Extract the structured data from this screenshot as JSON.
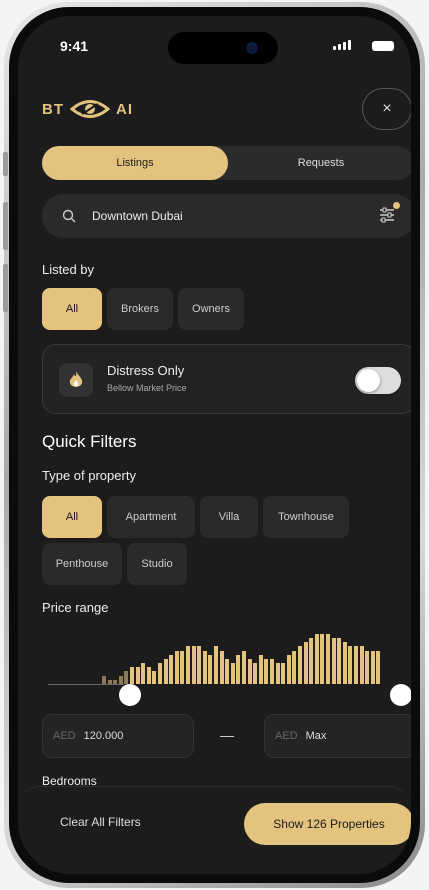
{
  "status_bar": {
    "time": "9:41"
  },
  "brand": {
    "left": "BT",
    "right": "AI",
    "accent": "#e3c37d"
  },
  "header": {
    "close_icon": "×"
  },
  "segments": [
    {
      "label": "Listings",
      "active": true
    },
    {
      "label": "Requests",
      "active": false
    }
  ],
  "search": {
    "value": "Downtown Dubai",
    "icon": "search-icon"
  },
  "listed_by": {
    "label": "Listed by",
    "options": [
      {
        "label": "All",
        "active": true
      },
      {
        "label": "Brokers",
        "active": false
      },
      {
        "label": "Owners",
        "active": false
      }
    ]
  },
  "distress": {
    "title": "Distress Only",
    "subtitle": "Bellow Market Price",
    "enabled": false
  },
  "quick_filters": {
    "title": "Quick Filters"
  },
  "property_type": {
    "label": "Type of property",
    "options": [
      {
        "label": "All",
        "active": true
      },
      {
        "label": "Apartment",
        "active": false
      },
      {
        "label": "Villa",
        "active": false
      },
      {
        "label": "Townhouse",
        "active": false
      },
      {
        "label": "Penthouse",
        "active": false
      },
      {
        "label": "Studio",
        "active": false
      }
    ]
  },
  "price_range": {
    "label": "Price range",
    "min_currency": "AED",
    "min_value": "120.000",
    "max_currency": "AED",
    "max_value": "Max",
    "histogram": [
      2,
      1,
      1,
      2,
      3,
      4,
      4,
      5,
      4,
      3,
      5,
      6,
      7,
      8,
      8,
      9,
      9,
      9,
      8,
      7,
      9,
      8,
      6,
      5,
      7,
      8,
      6,
      5,
      7,
      6,
      6,
      5,
      5,
      7,
      8,
      9,
      10,
      11,
      12,
      12,
      12,
      11,
      11,
      10,
      9,
      9,
      9,
      8,
      8,
      8
    ]
  },
  "bedrooms": {
    "label": "Bedrooms"
  },
  "footer": {
    "clear_label": "Clear All Filters",
    "show_label": "Show 126 Properties"
  }
}
